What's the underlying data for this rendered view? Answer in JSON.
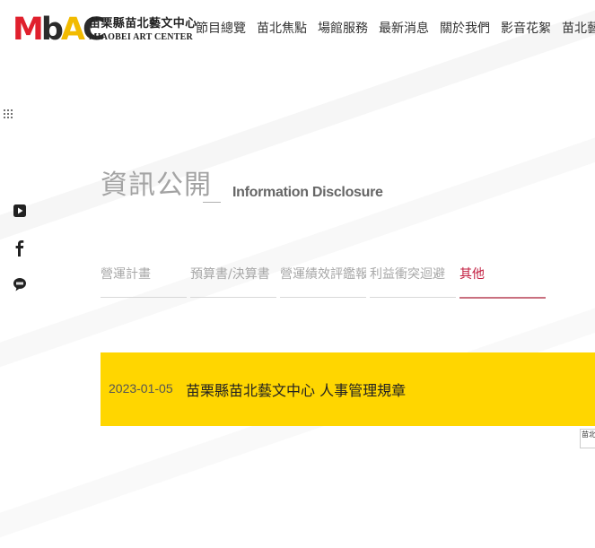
{
  "logo": {
    "mark": [
      "M",
      "b",
      "A",
      "C"
    ],
    "name_zh": "苗栗縣苗北藝文中心",
    "name_en": "MIAOBEI ART CENTER",
    "colors": {
      "M": "#e0202d",
      "b": "#2b2b2b",
      "A": "#f2bb00",
      "C": "#2b2b2b"
    }
  },
  "nav": {
    "items": [
      "節目總覽",
      "苗北焦點",
      "場館服務",
      "最新消息",
      "關於我們",
      "影音花絮",
      "苗北藝友"
    ]
  },
  "side": {
    "menu_icon": "grid-dots-icon",
    "social": [
      "youtube-icon",
      "facebook-icon",
      "line-icon"
    ]
  },
  "page": {
    "title_zh": "資訊公開",
    "title_en": "Information Disclosure"
  },
  "tabs": {
    "items": [
      "營運計畫",
      "預算書/決算書",
      "營運績效評鑑報告",
      "利益衝突迴避",
      "其他"
    ],
    "active": "其他"
  },
  "records": [
    {
      "date": "2023-01-05",
      "title": "苗栗縣苗北藝文中心 人事管理規章"
    }
  ],
  "corner_widget": {
    "text": "苗北"
  },
  "colors": {
    "accent": "#c21d3f",
    "highlight": "#ffd600",
    "muted_text": "#a7a7a7"
  }
}
